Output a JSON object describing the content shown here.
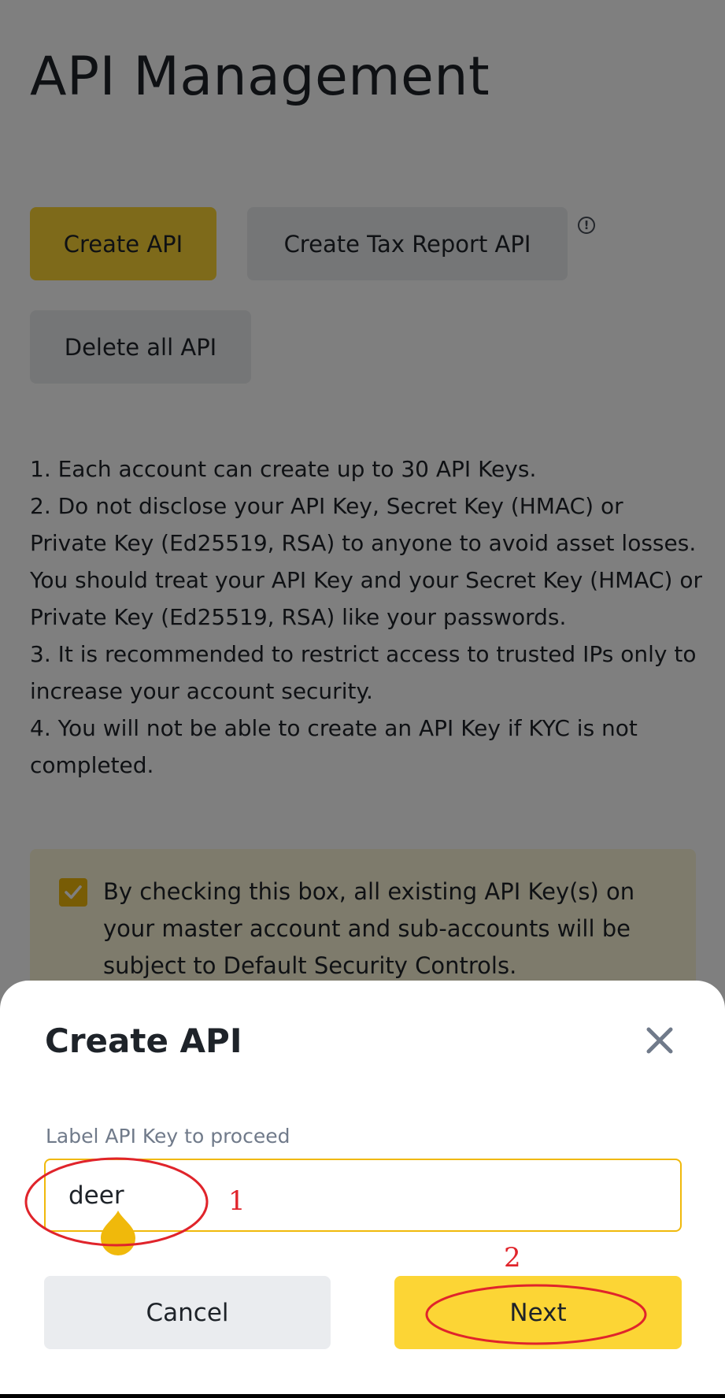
{
  "page": {
    "title": "API Management",
    "buttons": {
      "create_api": "Create API",
      "create_tax_report_api": "Create Tax Report API",
      "delete_all_api": "Delete all API"
    },
    "info_icon_glyph": "!",
    "notes": [
      "1. Each account can create up to 30 API Keys.",
      "2. Do not disclose your API Key, Secret Key (HMAC) or Private Key (Ed25519, RSA) to anyone to avoid asset losses. You should treat your API Key and your Secret Key (HMAC) or Private Key (Ed25519, RSA) like your passwords.",
      "3. It is recommended to restrict access to trusted IPs only to increase your account security.",
      "4. You will not be able to create an API Key if KYC is not completed."
    ],
    "notice": {
      "checked": true,
      "text": "By checking this box, all existing API Key(s) on your master account and sub-accounts will be subject to Default Security Controls."
    }
  },
  "dialog": {
    "title": "Create API",
    "field_label": "Label API Key to proceed",
    "field_value": "deer",
    "cancel_label": "Cancel",
    "next_label": "Next"
  },
  "annotations": {
    "step1": "1",
    "step2": "2"
  },
  "colors": {
    "brand_yellow": "#fcd535",
    "accent_gold": "#f0b90b",
    "annotation_red": "#e0242b",
    "secondary_gray": "#eaecef"
  },
  "icons": [
    "info-icon",
    "checkmark-icon",
    "close-icon"
  ]
}
